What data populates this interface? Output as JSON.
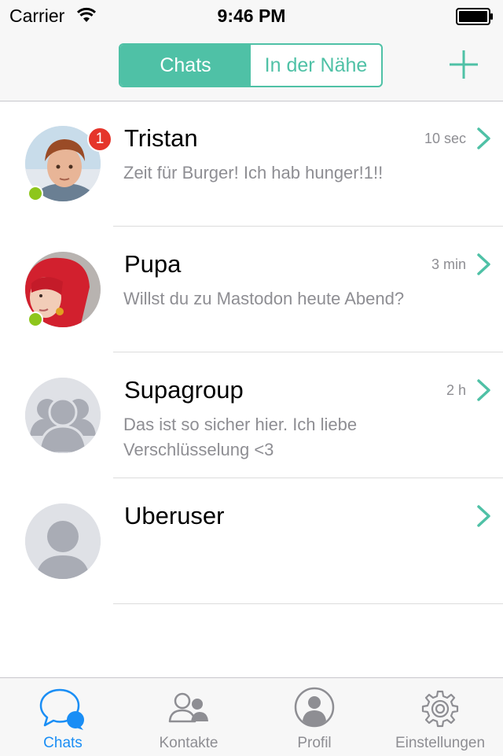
{
  "status_bar": {
    "carrier": "Carrier",
    "time": "9:46 PM"
  },
  "nav": {
    "segments": [
      "Chats",
      "In der Nähe"
    ],
    "active_segment": "Chats",
    "add_icon": "plus-icon"
  },
  "chats": [
    {
      "name": "Tristan",
      "preview": "Zeit für Burger! Ich hab hunger!1!!",
      "time": "10 sec",
      "unread": "1",
      "online": true,
      "avatar": "photo"
    },
    {
      "name": "Pupa",
      "preview": "Willst du zu Mastodon heute Abend?",
      "time": "3 min",
      "online": true,
      "avatar": "photo"
    },
    {
      "name": "Supagroup",
      "preview": "Das ist so sicher hier. Ich liebe Verschlüsselung <3",
      "time": "2 h",
      "online": false,
      "avatar": "group-placeholder"
    },
    {
      "name": "Uberuser",
      "preview": "",
      "time": "",
      "online": false,
      "avatar": "person-placeholder"
    }
  ],
  "tabbar": {
    "tabs": [
      {
        "label": "Chats",
        "icon": "chat-bubbles-icon",
        "active": true
      },
      {
        "label": "Kontakte",
        "icon": "contacts-icon",
        "active": false
      },
      {
        "label": "Profil",
        "icon": "profile-icon",
        "active": false
      },
      {
        "label": "Einstellungen",
        "icon": "gear-icon",
        "active": false
      }
    ]
  },
  "colors": {
    "accent": "#4fc1a6",
    "tab_active": "#1a8ef5",
    "badge": "#e5352b",
    "online": "#8ec61c",
    "secondary_text": "#8e8e93"
  }
}
